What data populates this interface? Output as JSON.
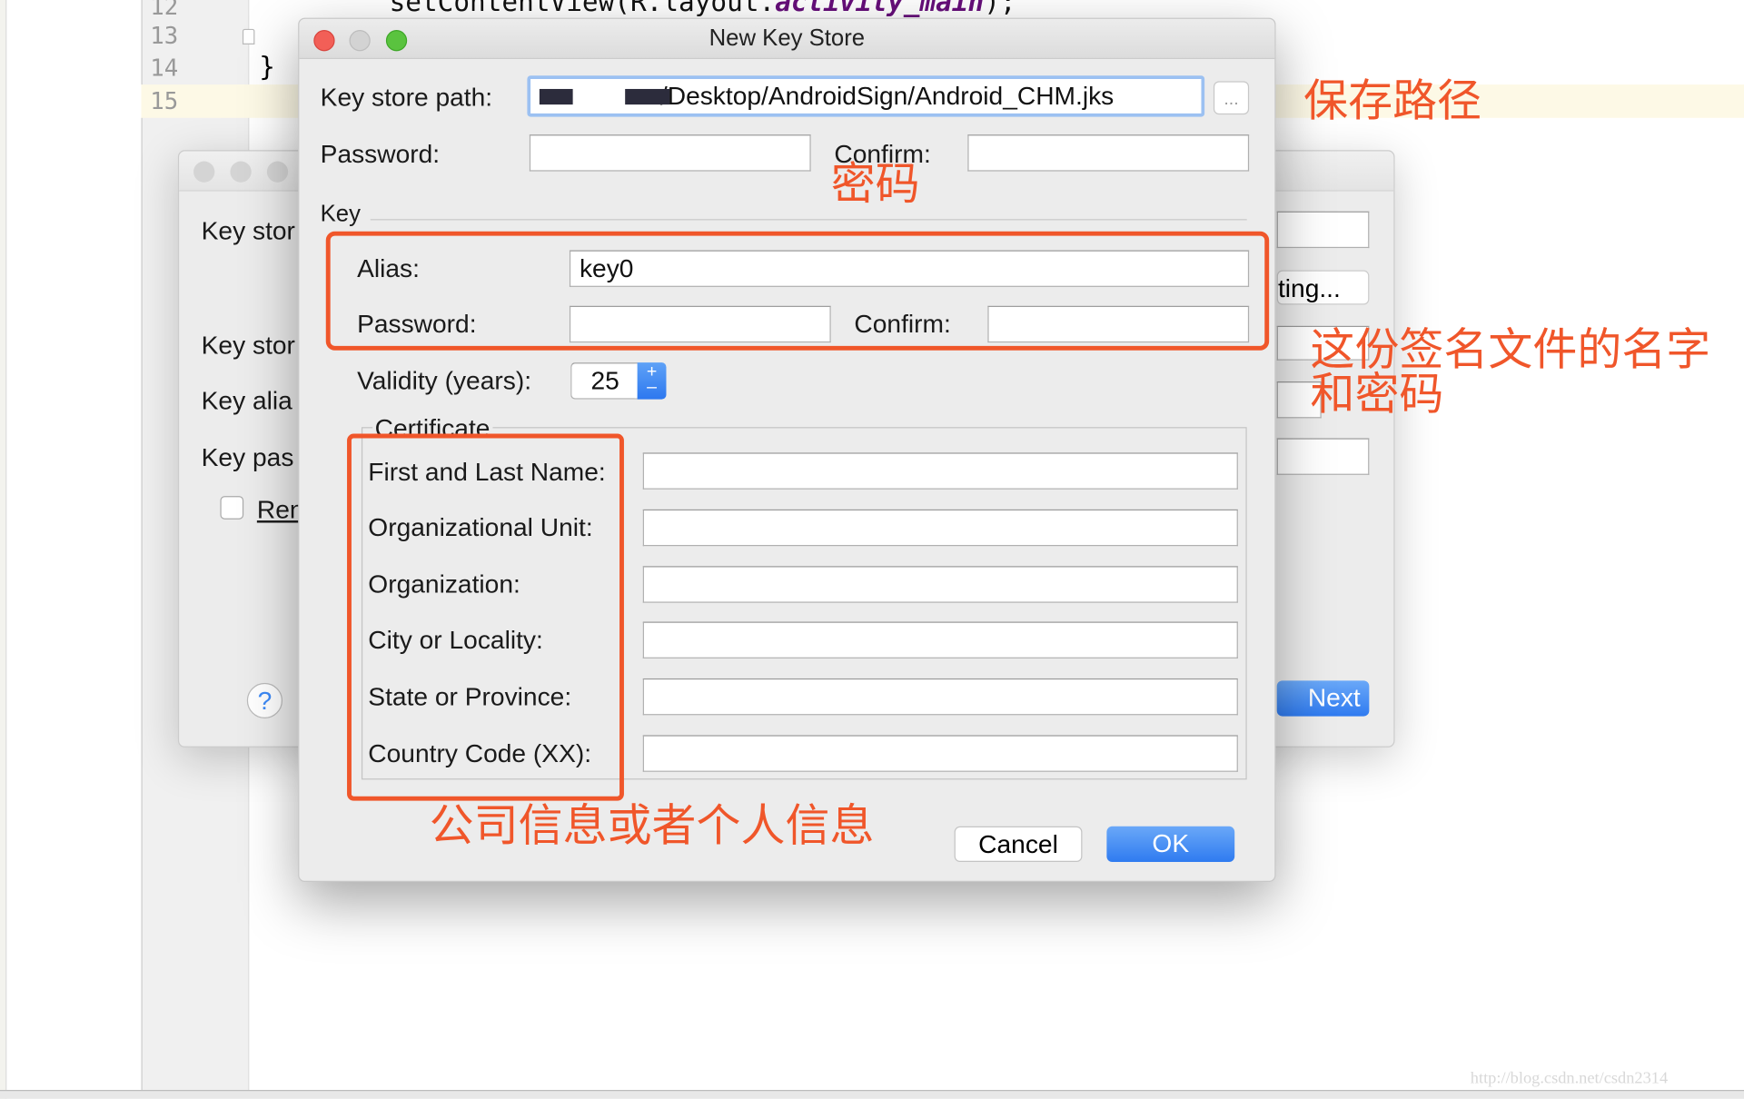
{
  "editor": {
    "line_numbers": [
      "12",
      "13",
      "14",
      "15"
    ],
    "code_line_prefix": "setContentView(R.layout.",
    "code_line_keyword": "activity_main",
    "code_line_suffix": ");",
    "closing_brace": "}"
  },
  "background_dialog": {
    "labels": [
      "Key stor",
      "Key stor",
      "Key alia",
      "Key pas"
    ],
    "remember_label": "Ren",
    "existing_button": "ting...",
    "next_button": "Next",
    "help_button": "?"
  },
  "dialog": {
    "title": "New Key Store",
    "key_store_path_label": "Key store path:",
    "key_store_path_value": "                 /Desktop/AndroidSign/Android_CHM.jks",
    "browse_button": "...",
    "password_label": "Password:",
    "confirm_label": "Confirm:",
    "key_section": "Key",
    "alias_label": "Alias:",
    "alias_value": "key0",
    "key_password_label": "Password:",
    "key_confirm_label": "Confirm:",
    "validity_label": "Validity (years):",
    "validity_value": "25",
    "certificate_section": "Certificate",
    "certificate_fields": [
      "First and Last Name:",
      "Organizational Unit:",
      "Organization:",
      "City or Locality:",
      "State or Province:",
      "Country Code (XX):"
    ],
    "cancel_button": "Cancel",
    "ok_button": "OK"
  },
  "annotations": {
    "save_path": "保存路径",
    "password": "密码",
    "name_and_password_line1": "这份签名文件的名字",
    "name_and_password_line2": "和密码",
    "company_info": "公司信息或者个人信息"
  },
  "watermark": "http://blog.csdn.net/csdn2314",
  "colors": {
    "annotation": "#f0562a",
    "accent": "#3d8af7"
  }
}
